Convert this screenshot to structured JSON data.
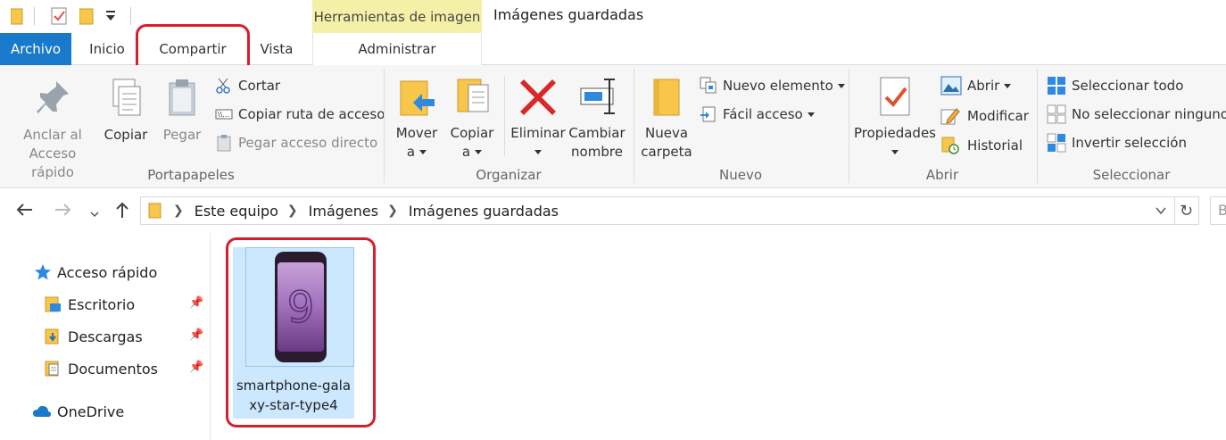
{
  "window": {
    "title": "Imágenes guardadas",
    "context_tab_group": "Herramientas de imagen"
  },
  "tabs": {
    "file": "Archivo",
    "home": "Inicio",
    "share": "Compartir",
    "view": "Vista",
    "manage": "Administrar"
  },
  "ribbon": {
    "clipboard": {
      "label": "Portapapeles",
      "pin_line1": "Anclar al",
      "pin_line2": "Acceso rápido",
      "copy": "Copiar",
      "paste": "Pegar",
      "cut": "Cortar",
      "copy_path": "Copiar ruta de acceso",
      "paste_shortcut": "Pegar acceso directo"
    },
    "organize": {
      "label": "Organizar",
      "move_line1": "Mover",
      "move_line2": "a",
      "copy_line1": "Copiar",
      "copy_line2": "a",
      "delete": "Eliminar",
      "rename_line1": "Cambiar",
      "rename_line2": "nombre"
    },
    "new": {
      "label": "Nuevo",
      "new_folder_line1": "Nueva",
      "new_folder_line2": "carpeta",
      "new_item": "Nuevo elemento",
      "easy_access": "Fácil acceso"
    },
    "open": {
      "label": "Abrir",
      "properties": "Propiedades",
      "open": "Abrir",
      "edit": "Modificar",
      "history": "Historial"
    },
    "select": {
      "label": "Seleccionar",
      "select_all": "Seleccionar todo",
      "select_none": "No seleccionar ninguno",
      "invert": "Invertir selección"
    }
  },
  "address": {
    "crumbs": [
      "Este equipo",
      "Imágenes",
      "Imágenes guardadas"
    ],
    "search_placeholder": "B"
  },
  "nav": {
    "quick_access": "Acceso rápido",
    "items": [
      "Escritorio",
      "Descargas",
      "Documentos"
    ],
    "onedrive": "OneDrive"
  },
  "files": [
    {
      "name": "smartphone-galaxy-star-type4",
      "selected": true
    }
  ],
  "colors": {
    "accent": "#1979ca",
    "context_tab": "#f5f0a8",
    "selection": "#cce8ff",
    "highlight_ring": "#d81d2c",
    "folder": "#f8c64a"
  }
}
